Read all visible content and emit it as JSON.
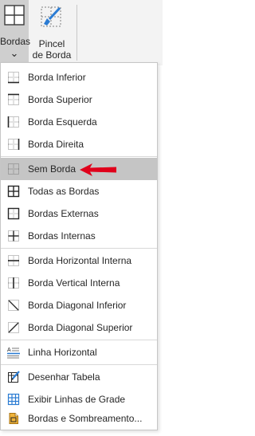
{
  "ribbon": {
    "borders_button_label": "Bordas",
    "borders_dropdown_glyph": "⌄",
    "painter_line1": "Pincel",
    "painter_line2": "de Borda"
  },
  "menu": {
    "items": [
      {
        "label": "Borda Inferior",
        "icon": "border-bottom-icon"
      },
      {
        "label": "Borda Superior",
        "icon": "border-top-icon"
      },
      {
        "label": "Borda Esquerda",
        "icon": "border-left-icon"
      },
      {
        "label": "Borda Direita",
        "icon": "border-right-icon"
      },
      {
        "label": "Sem Borda",
        "icon": "no-border-icon",
        "highlighted": true
      },
      {
        "label": "Todas as Bordas",
        "icon": "all-borders-icon"
      },
      {
        "label": "Bordas Externas",
        "icon": "outside-borders-icon"
      },
      {
        "label": "Bordas Internas",
        "icon": "inside-borders-icon"
      },
      {
        "label": "Borda Horizontal Interna",
        "icon": "inside-horizontal-border-icon"
      },
      {
        "label": "Borda Vertical Interna",
        "icon": "inside-vertical-border-icon"
      },
      {
        "label": "Borda Diagonal Inferior",
        "icon": "diagonal-down-border-icon"
      },
      {
        "label": "Borda Diagonal Superior",
        "icon": "diagonal-up-border-icon"
      },
      {
        "label": "Linha Horizontal",
        "icon": "horizontal-line-icon"
      },
      {
        "label": "Desenhar Tabela",
        "icon": "draw-table-icon"
      },
      {
        "label": "Exibir Linhas de Grade",
        "icon": "view-gridlines-icon"
      },
      {
        "label": "Bordas e Sombreamento...",
        "icon": "borders-shading-icon"
      }
    ]
  },
  "colors": {
    "highlight": "#c5c5c5",
    "arrow": "#e0001b",
    "accent_blue": "#2b7cd3"
  }
}
